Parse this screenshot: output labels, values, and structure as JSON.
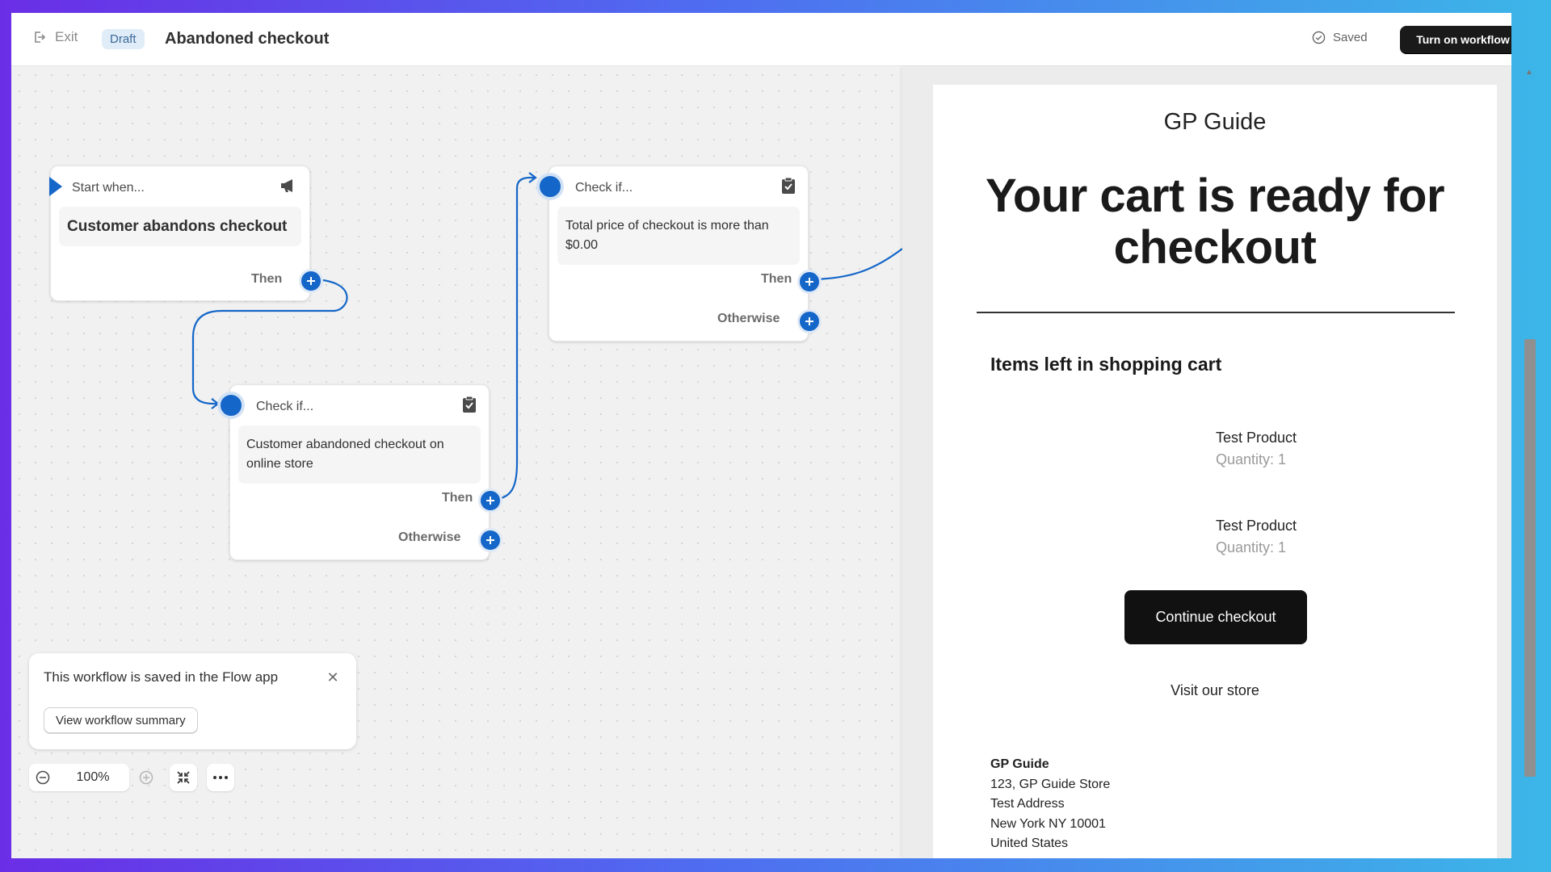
{
  "topbar": {
    "exit_label": "Exit",
    "status_badge": "Draft",
    "workflow_title": "Abandoned checkout",
    "saved_label": "Saved",
    "turn_on_label": "Turn on workflow"
  },
  "nodes": {
    "trigger": {
      "header": "Start when...",
      "body": "Customer abandons checkout",
      "then_label": "Then",
      "icon": "megaphone-icon"
    },
    "condition1": {
      "header": "Check if...",
      "body": "Customer abandoned checkout on online store",
      "then_label": "Then",
      "otherwise_label": "Otherwise",
      "icon": "clipboard-check-icon"
    },
    "condition2": {
      "header": "Check if...",
      "body": "Total price of checkout is more than $0.00",
      "then_label": "Then",
      "otherwise_label": "Otherwise",
      "icon": "clipboard-check-icon"
    }
  },
  "toast": {
    "message": "This workflow is saved in the Flow app",
    "button_label": "View workflow summary"
  },
  "zoom": {
    "value": "100%"
  },
  "email": {
    "brand": "GP Guide",
    "headline": "Your cart is ready for checkout",
    "items_title": "Items left in shopping cart",
    "products": [
      {
        "name": "Test Product",
        "quantity": "Quantity: 1"
      },
      {
        "name": "Test Product",
        "quantity": "Quantity: 1"
      }
    ],
    "cta_label": "Continue checkout",
    "visit_link": "Visit our store",
    "address": {
      "name": "GP Guide",
      "line1": "123, GP Guide Store",
      "line2": "Test Address",
      "line3": "New York NY 10001",
      "line4": "United States"
    }
  },
  "colors": {
    "accent": "#1466c8",
    "primary_button": "#1a1a1a"
  }
}
